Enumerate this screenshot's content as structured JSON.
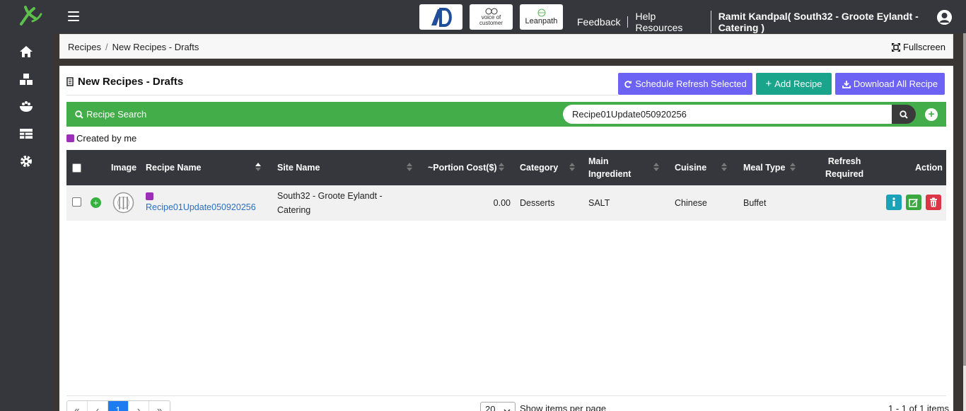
{
  "topbar": {
    "brands": {
      "ad": "AD",
      "voc_line1": "voice of",
      "voc_line2": "customer",
      "leanpath": "Leanpath"
    },
    "links": {
      "feedback": "Feedback",
      "help": "Help Resources",
      "user": "Ramit Kandpal( South32 - Groote Eylandt - Catering )"
    }
  },
  "sidebar": {
    "items": [
      {
        "icon": "home-icon"
      },
      {
        "icon": "boxes-icon"
      },
      {
        "icon": "food-bowl-icon"
      },
      {
        "icon": "table-icon"
      },
      {
        "icon": "gear-icon"
      }
    ]
  },
  "breadcrumb": {
    "root": "Recipes",
    "sep": "/",
    "current": "New Recipes - Drafts"
  },
  "fullscreen_label": "Fullscreen",
  "card": {
    "title": "New Recipes - Drafts",
    "buttons": {
      "schedule": "Schedule Refresh Selected",
      "add": "Add Recipe",
      "download": "Download All Recipe"
    },
    "search": {
      "label": "Recipe Search",
      "value": "Recipe01Update050920256",
      "placeholder": ""
    },
    "legend": "Created by me",
    "legend_color": "#9c2fb8"
  },
  "table": {
    "headers": {
      "image": "Image",
      "recipe_name": "Recipe Name",
      "site_name": "Site Name",
      "portion_cost": "~Portion Cost($)",
      "category": "Category",
      "main_ingredient_1": "Main",
      "main_ingredient_2": "Ingredient",
      "cuisine": "Cuisine",
      "meal_type": "Meal Type",
      "refresh_1": "Refresh",
      "refresh_2": "Required",
      "action": "Action"
    },
    "rows": [
      {
        "recipe_name": "Recipe01Update050920256",
        "site_line1": "South32 - Groote Eylandt -",
        "site_line2": "Catering",
        "portion_cost": "0.00",
        "category": "Desserts",
        "main_ingredient": "SALT",
        "cuisine": "Chinese",
        "meal_type": "Buffet",
        "refresh_required": ""
      }
    ]
  },
  "pagination": {
    "first": "«",
    "prev": "‹",
    "current": "1",
    "next": "›",
    "last": "»",
    "per_page": "20",
    "per_page_label": "Show items per page",
    "items_info": "1 - 1 of 1 items"
  },
  "colors": {
    "accent_purple": "#6c63f5",
    "accent_teal": "#1aa48b",
    "search_green": "#43ad4a",
    "dark": "#35373d"
  }
}
